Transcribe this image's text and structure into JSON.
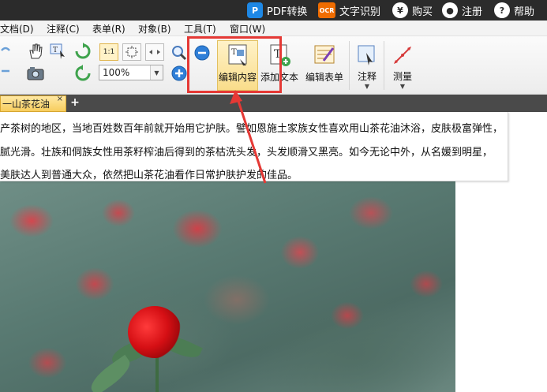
{
  "topbar": {
    "pdf_convert": "PDF转换",
    "ocr_badge": "OCR",
    "ocr_label": "文字识别",
    "buy_label": "购买",
    "register_label": "注册",
    "help_label": "帮助"
  },
  "menubar": {
    "items": [
      "文档(D)",
      "注释(C)",
      "表单(R)",
      "对象(B)",
      "工具(T)",
      "窗口(W)"
    ]
  },
  "toolbar": {
    "zoom_value": "100%",
    "edit_content": "编辑内容",
    "add_text": "添加文本",
    "edit_form": "编辑表单",
    "annotate": "注释",
    "measure": "测量",
    "fit_label": "1:1"
  },
  "tabs": {
    "active_tab": "一山茶花油",
    "close": "×",
    "add": "+"
  },
  "document": {
    "lines": [
      "产茶树的地区，当地百姓数百年前就开始用它护肤。譬如恩施土家族女性喜欢用山茶花油沐浴，皮肤极富弹性，",
      "腻光滑。壮族和侗族女性用茶籽榨油后得到的茶枯洗头发，头发顺滑又黑亮。如今无论中外，从名媛到明星，",
      "美肤达人到普通大众，依然把山茶花油看作日常护肤护发的佳品。"
    ]
  },
  "colors": {
    "highlight": "#e53935",
    "active_tab": "#f7cd5d",
    "topbar": "#2b2b2b"
  }
}
